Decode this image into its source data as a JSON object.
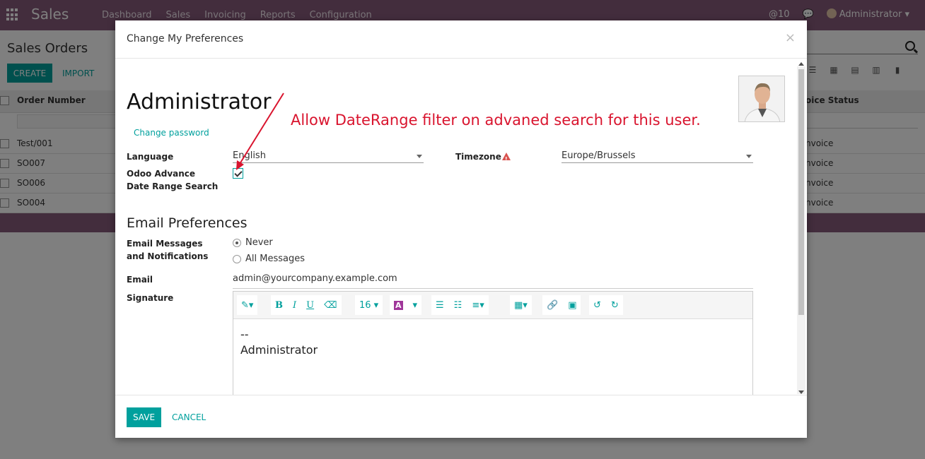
{
  "navbar": {
    "brand": "Sales",
    "menu": [
      "Dashboard",
      "Sales",
      "Invoicing",
      "Reports",
      "Configuration"
    ],
    "mentions_count": "@10",
    "user": "Administrator"
  },
  "control_panel": {
    "title": "Sales Orders",
    "create_label": "CREATE",
    "import_label": "IMPORT"
  },
  "list": {
    "col_order": "Order Number",
    "col_status": "oice Status",
    "rows": [
      {
        "order": "Test/001",
        "status": "nvoice"
      },
      {
        "order": "SO007",
        "status": "nvoice"
      },
      {
        "order": "SO006",
        "status": "nvoice"
      },
      {
        "order": "SO004",
        "status": "nvoice"
      }
    ]
  },
  "modal": {
    "title": "Change My Preferences",
    "close": "×",
    "user_name": "Administrator",
    "change_password": "Change password",
    "language_label": "Language",
    "language_value": "English",
    "timezone_label": "Timezone",
    "timezone_value": "Europe/Brussels",
    "advance_date_label": "Odoo Advance Date Range Search",
    "advance_date_checked": true,
    "email_section": "Email Preferences",
    "email_messages_label": "Email Messages and Notifications",
    "radio_never": "Never",
    "radio_all": "All Messages",
    "email_label": "Email",
    "email_value": "admin@yourcompany.example.com",
    "signature_label": "Signature",
    "font_size": "16",
    "signature_line1": "--",
    "signature_line2": "Administrator",
    "save_label": "SAVE",
    "cancel_label": "CANCEL"
  },
  "annotation": "Allow DateRange filter on advaned search for this user.",
  "colors": {
    "brand": "#875a7b",
    "accent": "#00a09d",
    "annotation": "#d9142e"
  }
}
